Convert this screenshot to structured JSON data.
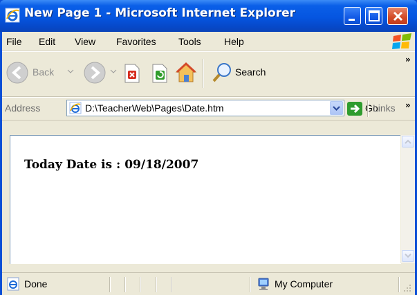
{
  "window": {
    "title": "New Page 1 - Microsoft Internet Explorer"
  },
  "menu": {
    "items": [
      "File",
      "Edit",
      "View",
      "Favorites",
      "Tools",
      "Help"
    ]
  },
  "toolbar": {
    "back_label": "Back",
    "search_label": "Search",
    "overflow": "»"
  },
  "address": {
    "label": "Address",
    "url": "D:\\TeacherWeb\\Pages\\Date.htm",
    "go_label": "Go",
    "links_label": "Links",
    "links_overflow": "»"
  },
  "page": {
    "content": "Today Date is : 09/18/2007"
  },
  "status": {
    "text": "Done",
    "zone": "My Computer"
  },
  "colors": {
    "titlebar": "#0555e0",
    "chrome": "#ece9d8",
    "close_button": "#d24a27"
  }
}
